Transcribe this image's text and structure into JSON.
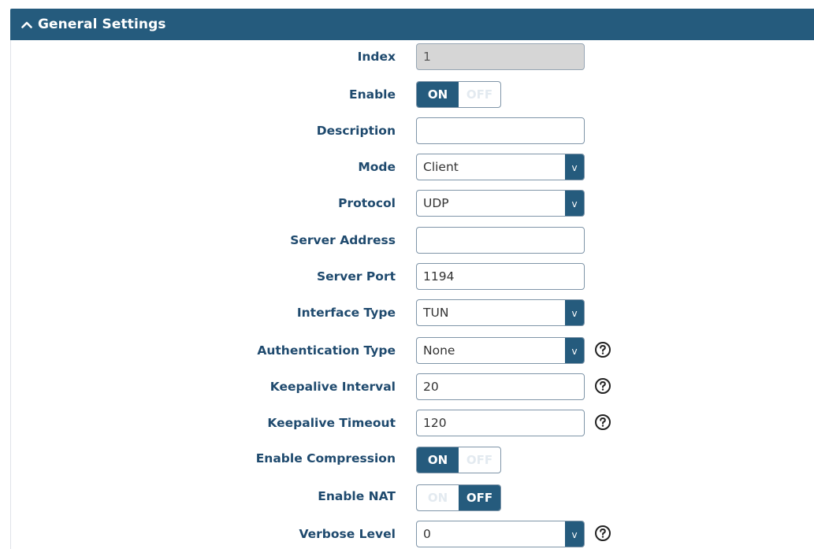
{
  "section": {
    "title": "General Settings"
  },
  "fields": {
    "index": {
      "label": "Index",
      "value": "1"
    },
    "enable": {
      "label": "Enable",
      "on_text": "ON",
      "off_text": "OFF",
      "state": "on"
    },
    "description": {
      "label": "Description",
      "value": ""
    },
    "mode": {
      "label": "Mode",
      "value": "Client"
    },
    "protocol": {
      "label": "Protocol",
      "value": "UDP"
    },
    "server_address": {
      "label": "Server Address",
      "value": ""
    },
    "server_port": {
      "label": "Server Port",
      "value": "1194"
    },
    "interface_type": {
      "label": "Interface Type",
      "value": "TUN"
    },
    "auth_type": {
      "label": "Authentication Type",
      "value": "None"
    },
    "keepalive_interval": {
      "label": "Keepalive Interval",
      "value": "20"
    },
    "keepalive_timeout": {
      "label": "Keepalive Timeout",
      "value": "120"
    },
    "enable_compression": {
      "label": "Enable Compression",
      "on_text": "ON",
      "off_text": "OFF",
      "state": "on"
    },
    "enable_nat": {
      "label": "Enable NAT",
      "on_text": "ON",
      "off_text": "OFF",
      "state": "off"
    },
    "verbose_level": {
      "label": "Verbose Level",
      "value": "0"
    }
  },
  "select_arrow": "v",
  "icons": {
    "collapse": "chevron-up-icon",
    "help": "help-circle-icon"
  },
  "colors": {
    "accent": "#255b7d",
    "label": "#1f4a6e",
    "field_border": "#7f95a8",
    "readonly_bg": "#d6d6d6"
  }
}
